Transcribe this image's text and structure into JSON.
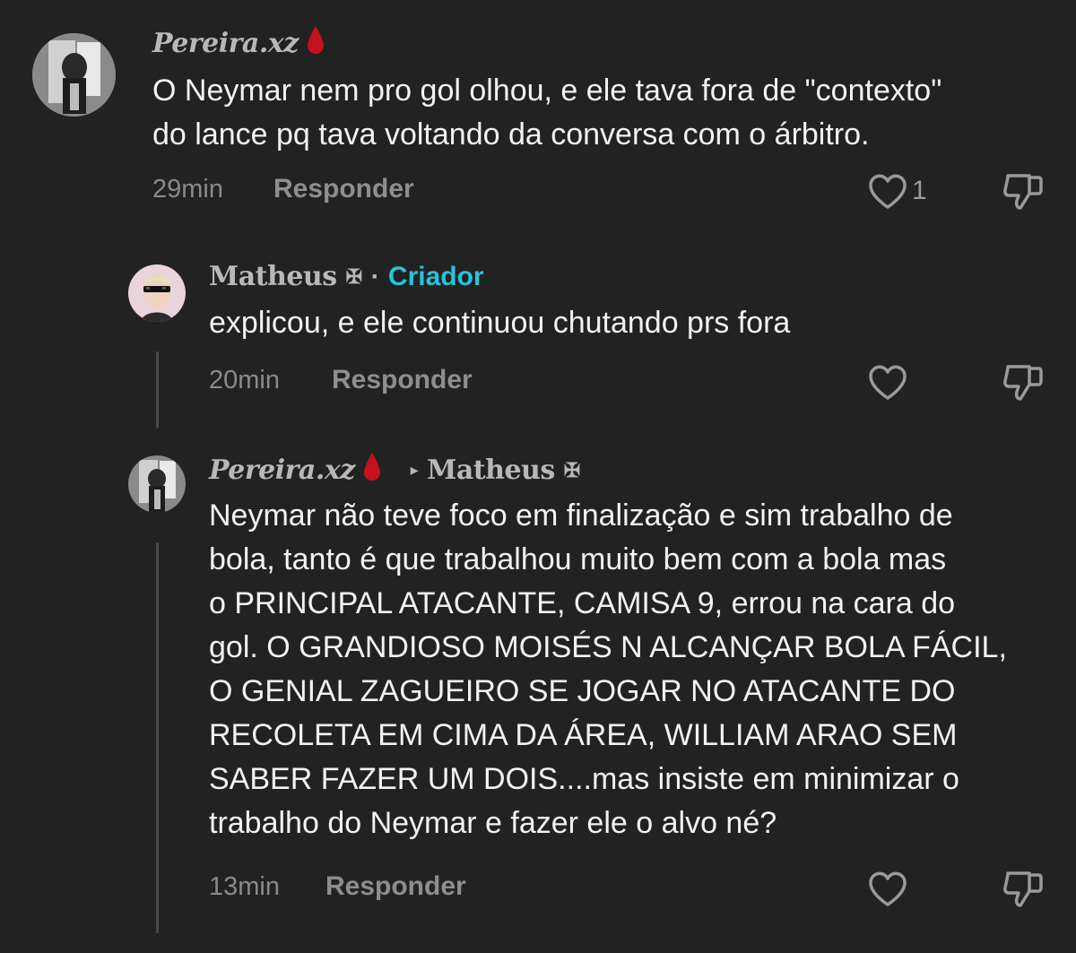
{
  "comments": [
    {
      "author": "Pereira.xz",
      "author_badge": "blood-drop-icon",
      "lines": [
        "O Neymar nem pro gol olhou, e ele tava fora de \"contexto\"",
        "do lance pq tava voltando da conversa com o árbitro."
      ],
      "time": "29min",
      "reply_label": "Responder",
      "likes": "1"
    },
    {
      "author": "Matheus",
      "author_symbol": "✠",
      "separator": "·",
      "role": "Criador",
      "lines": [
        "explicou, e ele continuou chutando prs fora"
      ],
      "time": "20min",
      "reply_label": "Responder"
    },
    {
      "author": "Pereira.xz",
      "author_badge": "blood-drop-icon",
      "reply_to": "Matheus",
      "reply_to_symbol": "✠",
      "reply_arrow": "▸",
      "lines": [
        "Neymar não teve foco em finalização e sim trabalho de",
        "bola, tanto é que trabalhou muito bem com a bola mas",
        "o PRINCIPAL ATACANTE, CAMISA 9, errou na cara do",
        "gol. O GRANDIOSO MOISÉS N ALCANÇAR BOLA FÁCIL,",
        "O GENIAL ZAGUEIRO SE JOGAR NO ATACANTE DO",
        "RECOLETA EM CIMA DA ÁREA, WILLIAM ARAO SEM",
        "SABER FAZER UM DOIS....mas insiste em minimizar o",
        "trabalho do Neymar e fazer ele o alvo né?"
      ],
      "time": "13min",
      "reply_label": "Responder"
    }
  ],
  "colors": {
    "background": "#222222",
    "creator": "#27c3d9",
    "blood_drop": "#c4121e"
  }
}
